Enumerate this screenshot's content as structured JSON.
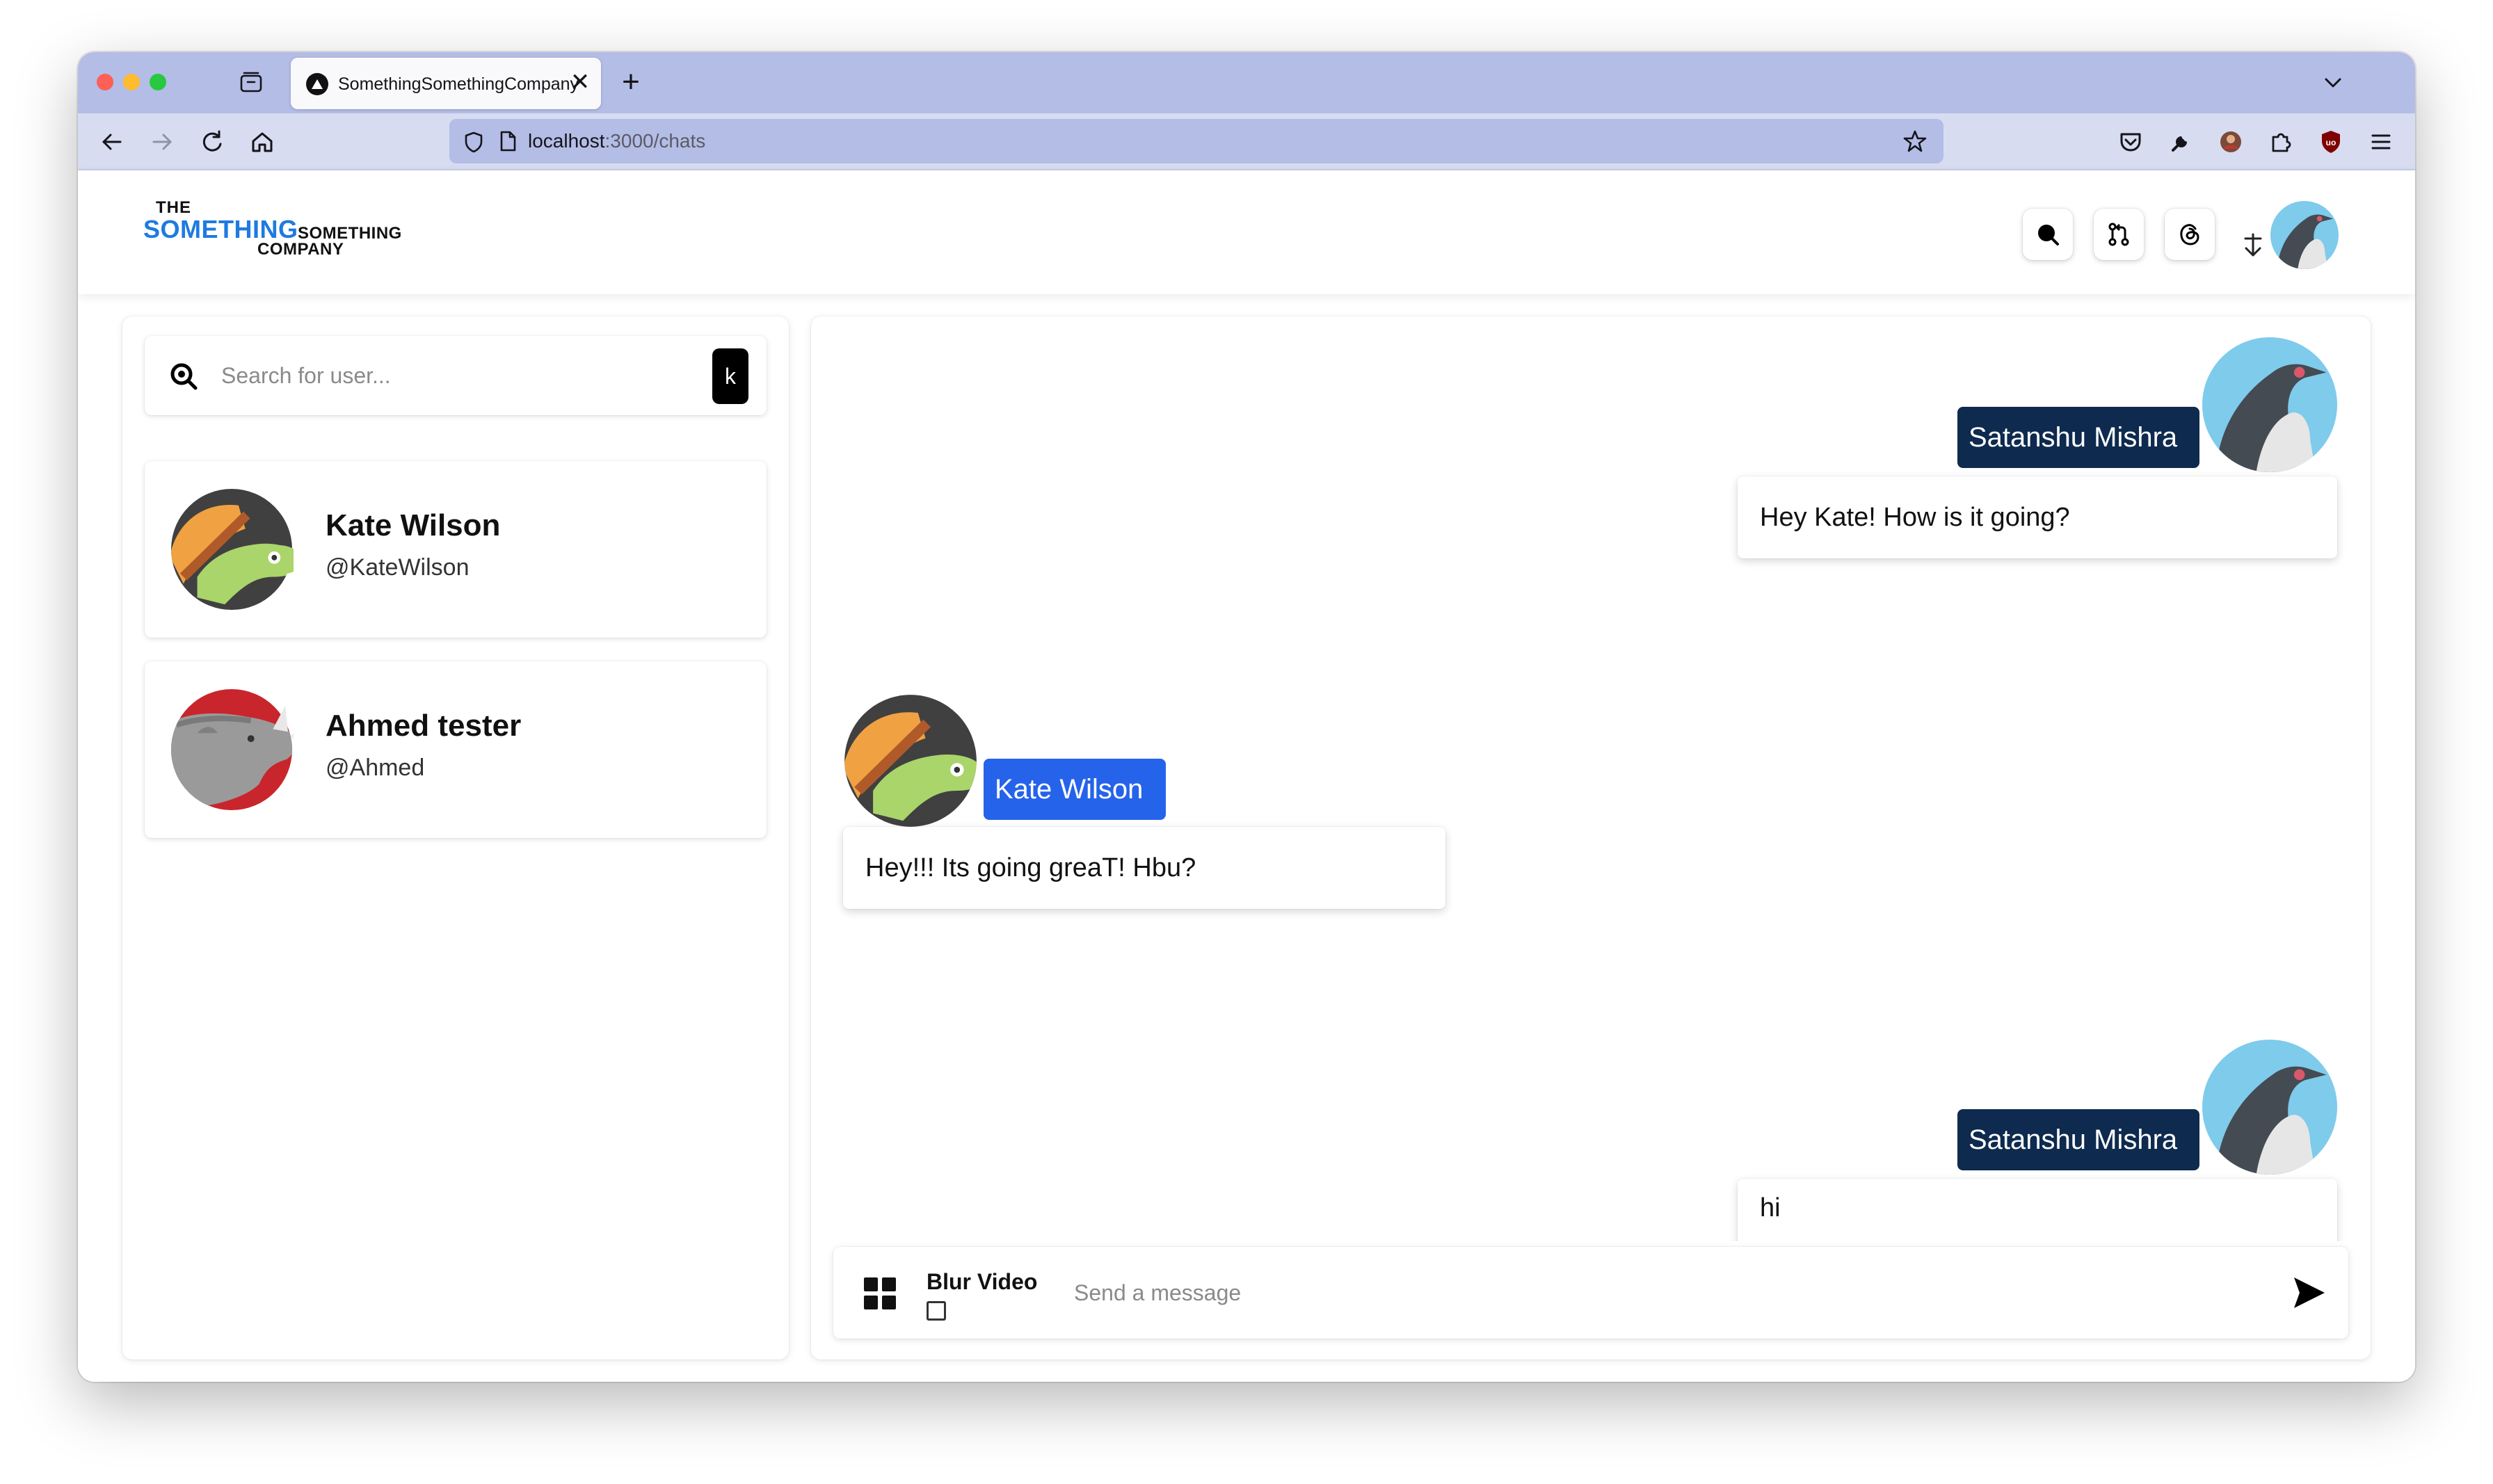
{
  "browser": {
    "tab_title": "SomethingSomethingCompany",
    "tab_close": "✕",
    "new_tab": "+",
    "url_host": "localhost",
    "url_path": ":3000/chats"
  },
  "logo": {
    "the": "THE",
    "something": "SOMETHING",
    "something2": "SOMETHING",
    "company": "COMPANY"
  },
  "sidebar": {
    "search_placeholder": "Search for user...",
    "shortcut": "k",
    "users": [
      {
        "name": "Kate Wilson",
        "handle": "@KateWilson"
      },
      {
        "name": "Ahmed tester",
        "handle": "@Ahmed"
      }
    ]
  },
  "chat": {
    "messages": [
      {
        "sender": "Satanshu Mishra",
        "text": "Hey Kate! How is it going?",
        "side": "right"
      },
      {
        "sender": "Kate Wilson",
        "text": "Hey!!! Its going greaT! Hbu?",
        "side": "left"
      },
      {
        "sender": "Satanshu Mishra",
        "text": "hi",
        "side": "right"
      }
    ]
  },
  "composer": {
    "blur_label": "Blur Video",
    "blur_checked": false,
    "placeholder": "Send a message"
  },
  "colors": {
    "my_name_tag": "#0e2a4e",
    "their_name_tag": "#2563eb",
    "logo_blue": "#1f7ae0",
    "browser_chrome": "#b3bde6"
  }
}
